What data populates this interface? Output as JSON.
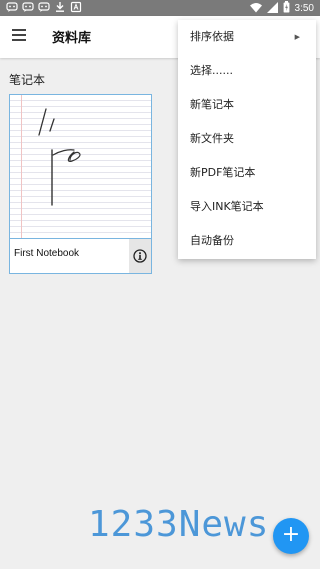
{
  "status_bar": {
    "left_icons": [
      "chat-app-icon",
      "chat-app-icon",
      "chat-app-icon",
      "download-icon",
      "a-app-icon"
    ],
    "right_icons": [
      "wifi-icon",
      "signal-icon",
      "battery-icon"
    ],
    "time": "3:50"
  },
  "app_bar": {
    "title": "资料库"
  },
  "section": {
    "title": "笔记本"
  },
  "notebook": {
    "name": "First Notebook",
    "info_glyph": "ℹ"
  },
  "menu": {
    "items": [
      {
        "label": "排序依据",
        "has_submenu": true
      },
      {
        "label": "选择......"
      },
      {
        "label": "新笔记本"
      },
      {
        "label": "新文件夹"
      },
      {
        "label": "新PDF笔记本"
      },
      {
        "label": "导入INK笔记本"
      },
      {
        "label": "自动备份"
      }
    ],
    "submenu_arrow": "▶"
  },
  "watermark": {
    "text": "1233News"
  },
  "fab": {
    "label": "+"
  },
  "colors": {
    "accent": "#2196f3",
    "card_border": "#79b5e0",
    "watermark": "#3b8ed6",
    "status_bar": "#7a7a7a",
    "background": "#efefef"
  }
}
